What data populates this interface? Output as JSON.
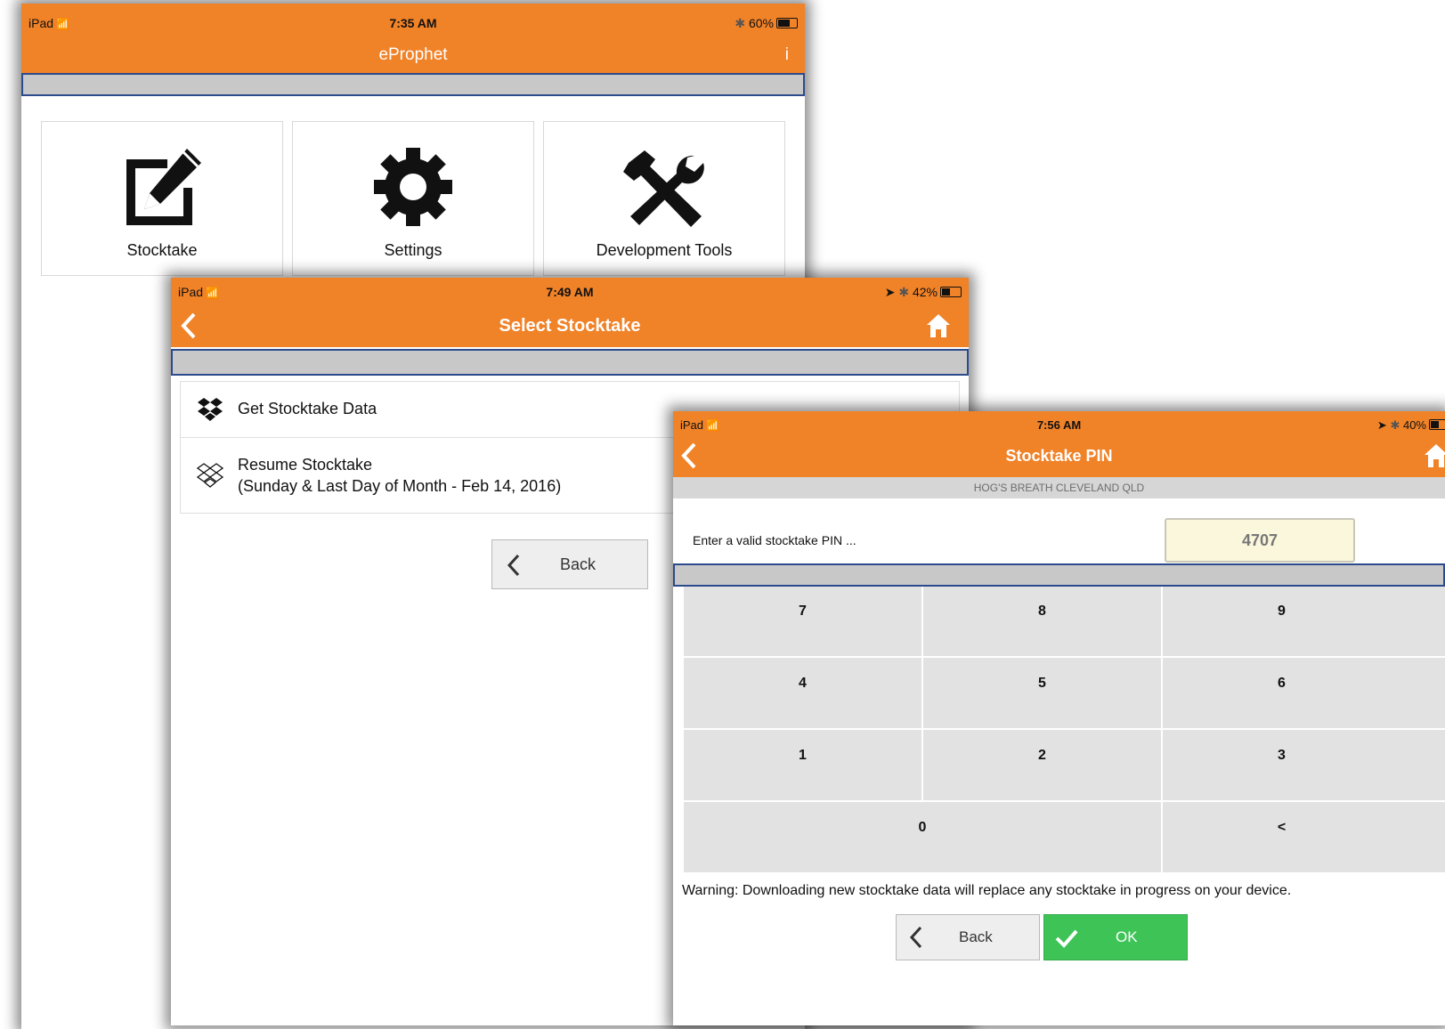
{
  "screens": {
    "home": {
      "status": {
        "device": "iPad",
        "time": "7:35 AM",
        "battery": "60%",
        "battery_level": 0.6
      },
      "title": "eProphet",
      "info_label": "i",
      "tiles": [
        {
          "label": "Stocktake",
          "icon": "edit-icon"
        },
        {
          "label": "Settings",
          "icon": "gear-icon"
        },
        {
          "label": "Development Tools",
          "icon": "tools-icon"
        }
      ]
    },
    "select": {
      "status": {
        "device": "iPad",
        "time": "7:49 AM",
        "battery": "42%",
        "battery_level": 0.42
      },
      "title": "Select Stocktake",
      "items": [
        {
          "label": "Get Stocktake Data",
          "icon": "dropbox-icon"
        },
        {
          "label": "Resume Stocktake",
          "sublabel": "(Sunday & Last Day of Month - Feb 14, 2016)",
          "icon": "dropbox-outline-icon"
        }
      ],
      "back_label": "Back"
    },
    "pin": {
      "status": {
        "device": "iPad",
        "time": "7:56 AM",
        "battery": "40%",
        "battery_level": 0.4
      },
      "title": "Stocktake PIN",
      "store": "HOG'S BREATH CLEVELAND QLD",
      "prompt": "Enter a valid stocktake PIN ...",
      "pin_value": "4707",
      "keys": [
        "7",
        "8",
        "9",
        "4",
        "5",
        "6",
        "1",
        "2",
        "3",
        "0",
        "<"
      ],
      "warning": "Warning: Downloading new stocktake data will replace any stocktake in progress on your device.",
      "back_label": "Back",
      "ok_label": "OK"
    }
  },
  "colors": {
    "accent": "#f08228",
    "ok": "#3ec357",
    "strip_border": "#2c4b8c"
  }
}
